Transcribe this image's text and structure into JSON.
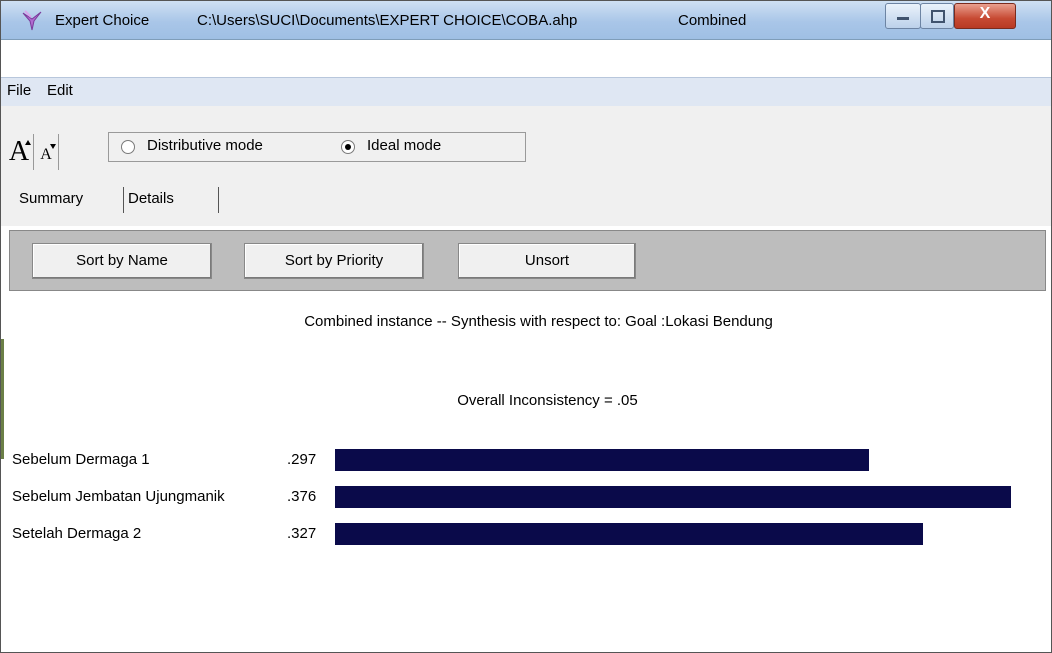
{
  "window": {
    "app_name": "Expert Choice",
    "file_path": "C:\\Users\\SUCI\\Documents\\EXPERT CHOICE\\COBA.ahp",
    "mode": "Combined",
    "close_label": "X"
  },
  "menu": {
    "file": "File",
    "edit": "Edit"
  },
  "toolbar": {
    "font_increase": "A",
    "font_decrease": "A",
    "distributive_label": "Distributive mode",
    "ideal_label": "Ideal mode",
    "selected_mode": "Ideal mode"
  },
  "tabs": {
    "summary": "Summary",
    "details": "Details",
    "active": "Summary"
  },
  "sortbar": {
    "sort_by_name": "Sort by Name",
    "sort_by_priority": "Sort by Priority",
    "unsort": "Unsort"
  },
  "synthesis": {
    "title": "Combined instance -- Synthesis with respect to: Goal :Lokasi Bendung",
    "inconsistency": "Overall Inconsistency = .05",
    "bar_color": "#0a0a4a"
  },
  "chart_data": {
    "type": "bar",
    "orientation": "horizontal",
    "categories": [
      "Sebelum Dermaga 1",
      "Sebelum Jembatan Ujungmanik",
      "Setelah Dermaga 2"
    ],
    "values": [
      0.297,
      0.376,
      0.327
    ],
    "value_labels": [
      ".297",
      ".376",
      ".327"
    ],
    "title": "",
    "xlabel": "",
    "ylabel": ""
  }
}
